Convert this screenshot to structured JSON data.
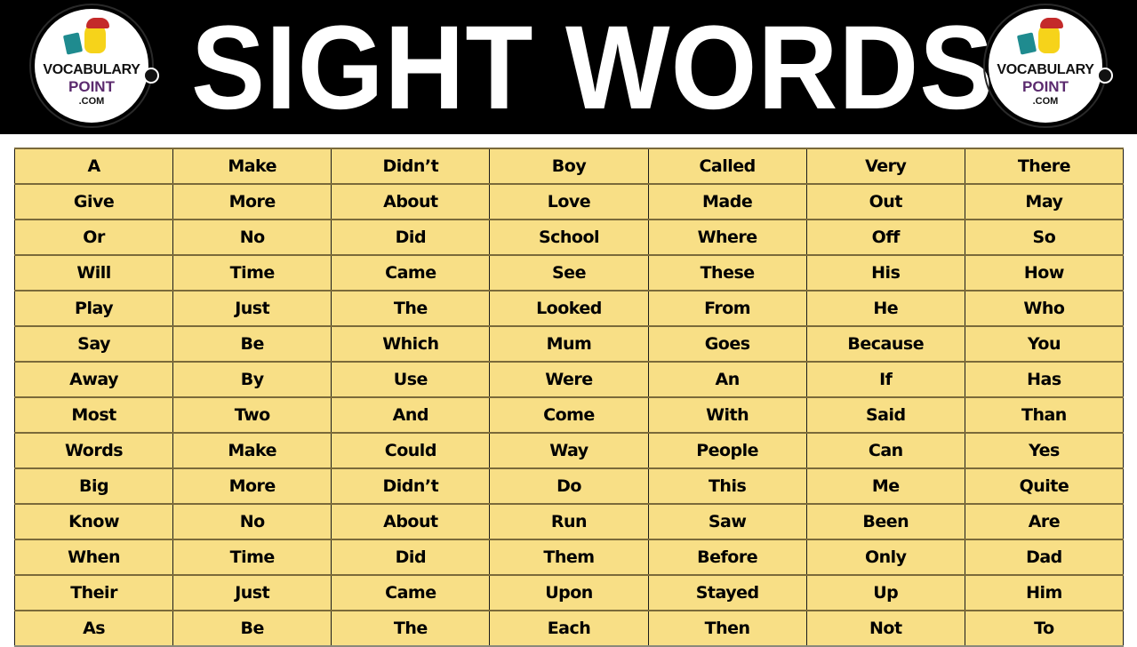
{
  "header": {
    "title": "SIGHT WORDS",
    "background_color": "#000000",
    "title_color": "#ffffff"
  },
  "logo": {
    "line1": "VOCABULARY",
    "line2": "POINT",
    "line3": ".COM",
    "accent_color": "#5b2a6e"
  },
  "table": {
    "cell_color": "#f8df86",
    "rows": [
      [
        "A",
        "Make",
        "Didn’t",
        "Boy",
        "Called",
        "Very",
        "There"
      ],
      [
        "Give",
        "More",
        "About",
        "Love",
        "Made",
        "Out",
        "May"
      ],
      [
        "Or",
        "No",
        "Did",
        "School",
        "Where",
        "Off",
        "So"
      ],
      [
        "Will",
        "Time",
        "Came",
        "See",
        "These",
        "His",
        "How"
      ],
      [
        "Play",
        "Just",
        "The",
        "Looked",
        "From",
        "He",
        "Who"
      ],
      [
        "Say",
        "Be",
        "Which",
        "Mum",
        "Goes",
        "Because",
        "You"
      ],
      [
        "Away",
        "By",
        "Use",
        "Were",
        "An",
        "If",
        "Has"
      ],
      [
        "Most",
        "Two",
        "And",
        "Come",
        "With",
        "Said",
        "Than"
      ],
      [
        "Words",
        "Make",
        "Could",
        "Way",
        "People",
        "Can",
        "Yes"
      ],
      [
        "Big",
        "More",
        "Didn’t",
        "Do",
        "This",
        "Me",
        "Quite"
      ],
      [
        "Know",
        "No",
        "About",
        "Run",
        "Saw",
        "Been",
        "Are"
      ],
      [
        "When",
        "Time",
        "Did",
        "Them",
        "Before",
        "Only",
        "Dad"
      ],
      [
        "Their",
        "Just",
        "Came",
        "Upon",
        "Stayed",
        "Up",
        "Him"
      ],
      [
        "As",
        "Be",
        "The",
        "Each",
        "Then",
        "Not",
        "To"
      ]
    ]
  }
}
